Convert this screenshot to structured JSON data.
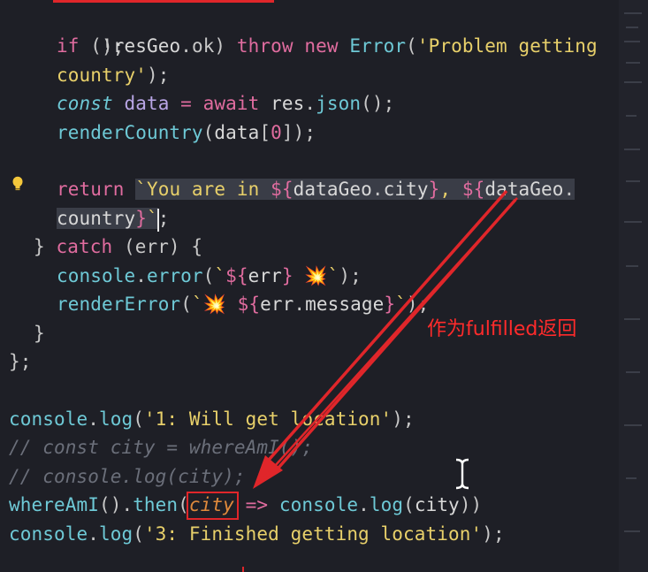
{
  "annotation": {
    "label": "作为fulfilled返回",
    "color": "#ff2b2b"
  },
  "code": {
    "l01_punc": ");",
    "l02_if": "if",
    "l02_a": " (!",
    "l02_res": "resGeo",
    "l02_b": ".ok) ",
    "l02_throw": "throw",
    "l02_sp": " ",
    "l02_new": "new",
    "l02_sp2": " ",
    "l02_err": "Error",
    "l02_p": "(",
    "l02_str": "'Problem getting",
    "l03_str": "country'",
    "l03_p": ");",
    "l04_const": "const",
    "l04_data": " data",
    "l04_eq": " = ",
    "l04_await": "await",
    "l04_res": " res",
    "l04_dot": ".",
    "l04_json": "json",
    "l04_p": "();",
    "l05_fn": "renderCountry",
    "l05_p": "(",
    "l05_data": "data",
    "l05_br": "[",
    "l05_zero": "0",
    "l05_end": "]);",
    "l07_return": "return",
    "l07_sp": " ",
    "l07_tick": "`You are in ",
    "l07_i1": "${",
    "l07_dg": "dataGeo",
    "l07_dot": ".",
    "l07_city": "city",
    "l07_i2": "}",
    "l07_comma": ", ",
    "l07_i3": "${",
    "l07_dg2": "dataGeo",
    "l07_dot2": ".",
    "l08_country": "country",
    "l08_i": "}",
    "l08_tick": "`",
    "l08_semi": ";",
    "l09_brace": "} ",
    "l09_catch": "catch",
    "l09_rest": " (err) {",
    "l10_console": "console",
    "l10_dot": ".",
    "l10_error": "error",
    "l10_p": "(",
    "l10_tick": "`",
    "l10_i1": "${",
    "l10_err": "err",
    "l10_i2": "}",
    "l10_tail": " 💥`",
    "l10_end": ");",
    "l11_fn": "renderError",
    "l11_p": "(",
    "l11_tick": "`💥 ",
    "l11_i1": "${",
    "l11_err": "err",
    "l11_dot": ".",
    "l11_msg": "message",
    "l11_i2": "}",
    "l11_tick2": "`",
    "l11_end": ");",
    "l12_brace": "}",
    "l13_end": "};",
    "l15_console": "console",
    "l15_dot": ".",
    "l15_log": "log",
    "l15_p": "(",
    "l15_str": "'1: Will get location'",
    "l15_end": ");",
    "l16_comment": "// const city = whereAmI();",
    "l17_comment": "// console.log(city);",
    "l18_fn": "whereAmI",
    "l18_a": "().",
    "l18_then": "then",
    "l18_p": "(",
    "l18_city": "city",
    "l18_arrow": " => ",
    "l18_console": "console",
    "l18_dot": ".",
    "l18_log": "log",
    "l18_p2": "(",
    "l18_city2": "city",
    "l18_end": "))",
    "l19_console": "console",
    "l19_dot": ".",
    "l19_log": "log",
    "l19_p": "(",
    "l19_str": "'3: Finished getting location'",
    "l19_end": ");"
  }
}
